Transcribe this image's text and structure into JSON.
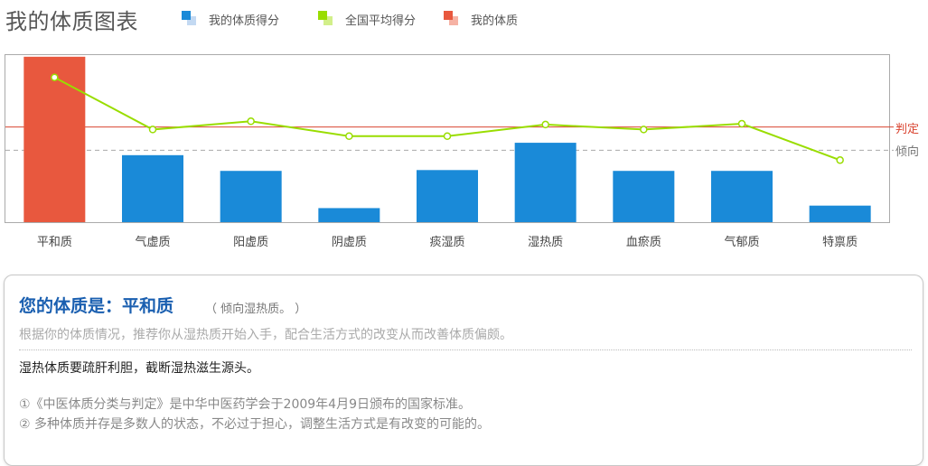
{
  "header": {
    "title": "我的体质图表",
    "legend": [
      {
        "label": "我的体质得分",
        "color": "#1a8ad8",
        "color2": "#c3d9f2"
      },
      {
        "label": "全国平均得分",
        "color": "#99dd00",
        "color2": "#d2ef8a"
      },
      {
        "label": "我的体质",
        "color": "#e8583e",
        "color2": "#f6b2a4"
      }
    ]
  },
  "chart_data": {
    "type": "bar",
    "categories": [
      "平和质",
      "气虚质",
      "阳虚质",
      "阴虚质",
      "痰湿质",
      "湿热质",
      "血瘀质",
      "气郁质",
      "特禀质"
    ],
    "series": [
      {
        "name": "我的体质得分",
        "type": "bar",
        "color": "#1a8ad8",
        "values": [
          100,
          40.5,
          31,
          8.5,
          31.5,
          48,
          31,
          31,
          10
        ]
      },
      {
        "name": "全国平均得分",
        "type": "line",
        "color": "#99dd00",
        "values": [
          87.5,
          56,
          61,
          52,
          52,
          59,
          56,
          59.5,
          37.5
        ]
      }
    ],
    "highlight": {
      "category": "平和质",
      "color": "#e8583e"
    },
    "reference_lines": [
      {
        "label": "判定",
        "value": 57.5,
        "color": "#d94430",
        "style": "solid"
      },
      {
        "label": "倾向",
        "value": 43.5,
        "color": "#aaaaaa",
        "style": "dashed"
      }
    ],
    "ylim": [
      0,
      101
    ],
    "grid": false
  },
  "result": {
    "heading": "您的体质是：平和质",
    "tendency": "（ 倾向湿热质。 ）",
    "recommendation": "根据你的体质情况，推荐你从湿热质开始入手，配合生活方式的改变从而改善体质偏颇。",
    "advice": "湿热体质要疏肝利胆，截断湿热滋生源头。",
    "notes": [
      "①《中医体质分类与判定》是中华中医药学会于2009年4月9日颁布的国家标准。",
      "② 多种体质并存是多数人的状态，不必过于担心，调整生活方式是有改变的可能的。"
    ]
  }
}
